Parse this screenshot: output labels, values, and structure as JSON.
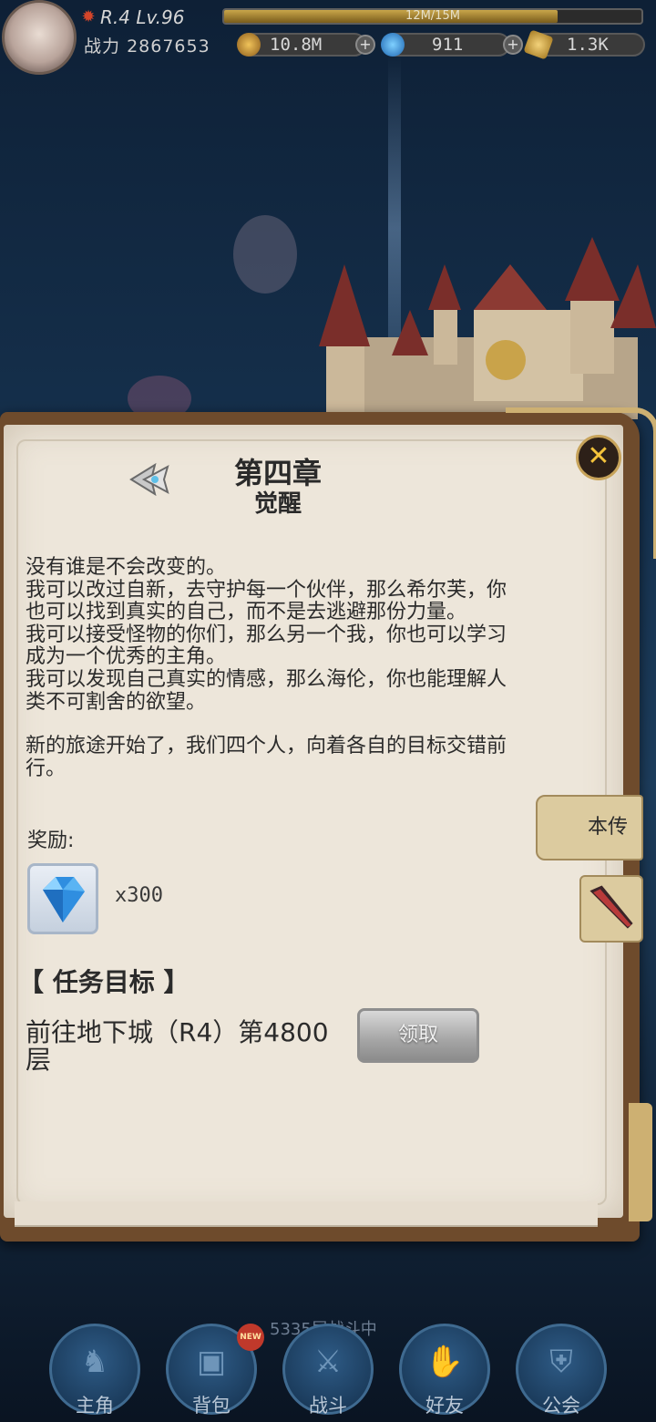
{
  "topbar": {
    "rank_level": "R.4 Lv.96",
    "exp_text": "12M/15M",
    "exp_progress": 0.8,
    "power_label": "战力",
    "power_value": "2867653",
    "gold": "10.8M",
    "gems": "911",
    "tokens": "1.3K"
  },
  "dialog": {
    "chapter_title": "第四章",
    "chapter_subtitle": "觉醒",
    "story": [
      "没有谁是不会改变的。",
      "我可以改过自新，去守护每一个伙伴，那么希尔芙，你也可以找到真实的自己，而不是去逃避那份力量。",
      "我可以接受怪物的你们，那么另一个我，你也可以学习成为一个优秀的主角。",
      "我可以发现自己真实的情感，那么海伦，你也能理解人类不可割舍的欲望。",
      "",
      "新的旅途开始了，我们四个人，向着各自的目标交错前行。"
    ],
    "reward_label": "奖励:",
    "reward_qty": "x300",
    "task_header": "【 任务目标 】",
    "task_desc": "前往地下城（R4）第4800层",
    "claim_label": "领取"
  },
  "side_tabs": {
    "biography": "本传"
  },
  "bottom": {
    "battle_status": "5335层战斗中",
    "new_badge": "NEW",
    "nav": [
      {
        "label": "主角"
      },
      {
        "label": "背包"
      },
      {
        "label": "战斗"
      },
      {
        "label": "好友"
      },
      {
        "label": "公会"
      }
    ]
  },
  "colors": {
    "accent_gold": "#f4c33b",
    "paper": "#ede6da",
    "frame": "#6e4b2c",
    "nav_blue": "#1c3d5e"
  },
  "icons": {
    "rank": "rank-emblem-icon",
    "gold": "gold-coin-icon",
    "gem": "blue-gem-icon",
    "token": "gold-ticket-icon",
    "close": "close-x-icon",
    "back": "arrow-left-icon",
    "reward": "blue-gem-icon",
    "weapon": "dark-blade-icon"
  }
}
